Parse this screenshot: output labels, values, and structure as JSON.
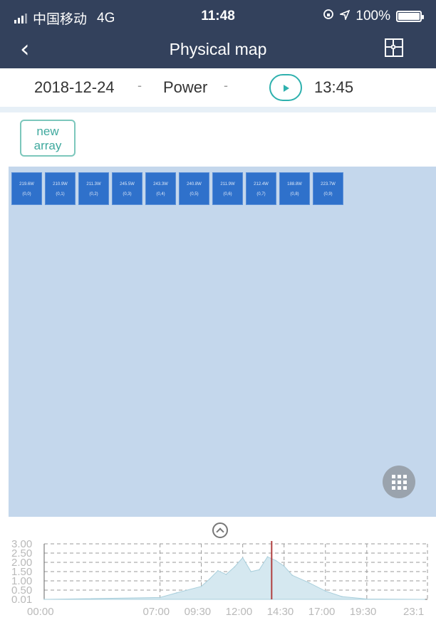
{
  "status": {
    "carrier": "中国移动",
    "network": "4G",
    "time": "11:48",
    "battery_percent": "100%",
    "battery_level": 1.0,
    "icons": [
      "signal-icon",
      "lock-rotation-icon",
      "location-icon",
      "battery-icon"
    ]
  },
  "nav": {
    "back_icon": "chevron-left-icon",
    "title": "Physical map",
    "map_icon": "floor-plan-icon"
  },
  "filter": {
    "date": "2018-12-24",
    "metric": "Power",
    "dropdown_glyph": "-",
    "play_icon": "play-icon",
    "time": "13:45"
  },
  "new_array": {
    "line1": "new",
    "line2": "array"
  },
  "panels": [
    {
      "value": "219.6W",
      "id": "(0,0)"
    },
    {
      "value": "210.9W",
      "id": "(0,1)"
    },
    {
      "value": "211.3W",
      "id": "(0,2)"
    },
    {
      "value": "245.5W",
      "id": "(0,3)"
    },
    {
      "value": "243.3W",
      "id": "(0,4)"
    },
    {
      "value": "240.8W",
      "id": "(0,5)"
    },
    {
      "value": "211.9W",
      "id": "(0,6)"
    },
    {
      "value": "212.4W",
      "id": "(0,7)"
    },
    {
      "value": "188.8W",
      "id": "(0,8)"
    },
    {
      "value": "223.7W",
      "id": "(0,9)"
    }
  ],
  "colors": {
    "nav_bg": "#33415c",
    "accent": "#2fb1ae",
    "panel": "#2f71cb",
    "map_bg": "#c4d7ec",
    "chart_fill": "#d5e8f0",
    "cursor": "#b04040"
  },
  "chart_data": {
    "type": "area",
    "ylim": [
      0,
      3.0
    ],
    "y_ticks": [
      "3.00",
      "2.50",
      "2.00",
      "1.50",
      "1.00",
      "0.50",
      "0.01"
    ],
    "x_ticks": [
      "00:00",
      "07:00",
      "09:30",
      "12:00",
      "14:30",
      "17:00",
      "19:30",
      "23:1"
    ],
    "grid": true,
    "cursor_time": "13:45",
    "series": [
      {
        "x": [
          "00:00",
          "07:00",
          "08:00",
          "09:30",
          "10:00",
          "10:30",
          "11:00",
          "11:30",
          "12:00",
          "12:30",
          "13:00",
          "13:30",
          "14:00",
          "14:30",
          "15:00",
          "16:00",
          "17:00",
          "18:00",
          "19:30",
          "23:00"
        ],
        "values": [
          0.0,
          0.1,
          0.35,
          0.7,
          1.1,
          1.55,
          1.35,
          1.75,
          2.25,
          1.5,
          1.6,
          2.3,
          2.1,
          1.8,
          1.3,
          0.9,
          0.45,
          0.15,
          0.02,
          0.0
        ]
      }
    ]
  }
}
